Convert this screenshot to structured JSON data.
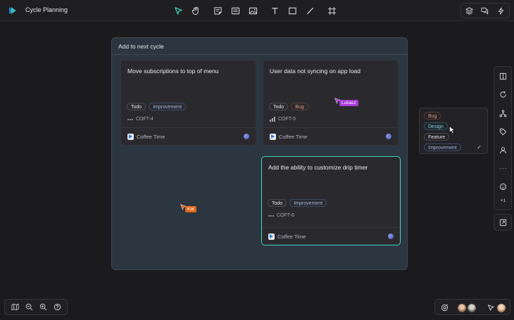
{
  "app": {
    "title": "Cycle Planning"
  },
  "toolbar": {
    "tools": [
      "pointer-icon",
      "hand-icon",
      "sticky-note-icon",
      "card-icon",
      "image-icon",
      "text-icon",
      "rectangle-icon",
      "line-icon",
      "frame-icon"
    ],
    "active_tool": "pointer-icon",
    "right": [
      "layers-icon",
      "comments-icon",
      "lightning-icon"
    ]
  },
  "frame": {
    "title": "Add to next cycle",
    "cards": [
      {
        "title": "Move subscriptions to top of menu",
        "status": "Todo",
        "label": "Improvement",
        "priority_icon": "dots-icon",
        "id": "COFT-4",
        "project": "Coffee Time"
      },
      {
        "title": "User data not syncing on app load",
        "status": "Todo",
        "label": "Bug",
        "priority_icon": "bars-icon",
        "id": "COFT-5",
        "project": "Coffee Time"
      },
      {
        "title": "Add the ability to customize drip timer",
        "status": "Todo",
        "label": "Improvement",
        "priority_icon": "dots-icon",
        "id": "COFT-6",
        "project": "Coffee Time"
      }
    ]
  },
  "cursors": [
    {
      "name": "Lukasz",
      "color": "#a83ad8"
    },
    {
      "name": "Kat",
      "color": "#e0681c"
    }
  ],
  "label_menu": {
    "items": [
      "Bug",
      "Design",
      "Feature",
      "Improvement"
    ],
    "selected": "Improvement",
    "check": "✓"
  },
  "sidebar": {
    "items": [
      "columns-icon",
      "refresh-icon",
      "hierarchy-icon",
      "tag-icon",
      "user-icon",
      "more-dashes-icon",
      "emoji-icon",
      "plus-one-icon"
    ],
    "plus_one": "+1",
    "extra": "external-link-icon"
  },
  "bottom_left": [
    "map-icon",
    "zoom-out-icon",
    "zoom-in-icon",
    "help-icon"
  ],
  "bottom_right": [
    "ai-icon",
    "avatar-1",
    "avatar-2",
    "presenter-icon",
    "avatar-3"
  ],
  "colors": {
    "accent": "#3fd4c0",
    "active_border": "#3fd4c0",
    "frame_bg": "#2b3640"
  }
}
